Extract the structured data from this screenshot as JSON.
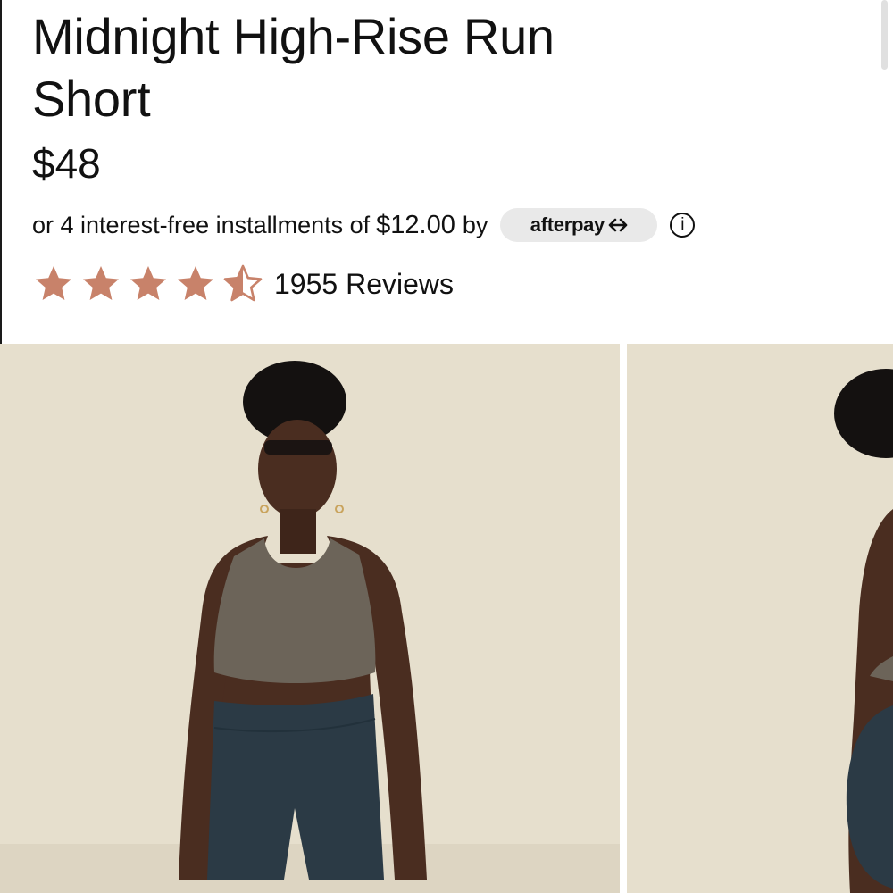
{
  "product": {
    "title_line1": "Midnight High-Rise Run",
    "title_line2": "Short",
    "price": "$48"
  },
  "afterpay": {
    "prefix": "or 4 interest-free installments of",
    "amount": "$12.00",
    "suffix": "by",
    "logo_text": "afterpay",
    "info_glyph": "i"
  },
  "rating": {
    "stars": 4.5,
    "reviews_label": "1955 Reviews",
    "star_color": "#c8826a"
  },
  "gallery": {
    "images": [
      {
        "name": "product-photo-front"
      },
      {
        "name": "product-photo-back"
      }
    ]
  },
  "colors": {
    "photo_background": "#e6dfcd",
    "short_color": "#2b3a45",
    "bra_color": "#6c6459"
  }
}
